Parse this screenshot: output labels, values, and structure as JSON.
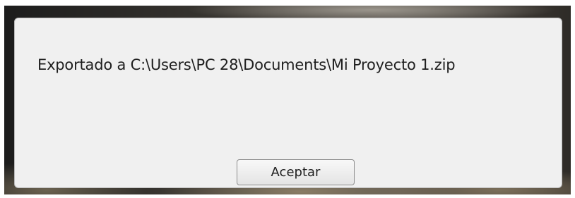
{
  "dialog": {
    "message": "Exportado a C:\\Users\\PC 28\\Documents\\Mi Proyecto 1.zip",
    "ok_label": "Aceptar"
  },
  "colors": {
    "dialog_background": "#f0f0f0",
    "frame_border": "#000000",
    "text": "#1e1e1e"
  }
}
